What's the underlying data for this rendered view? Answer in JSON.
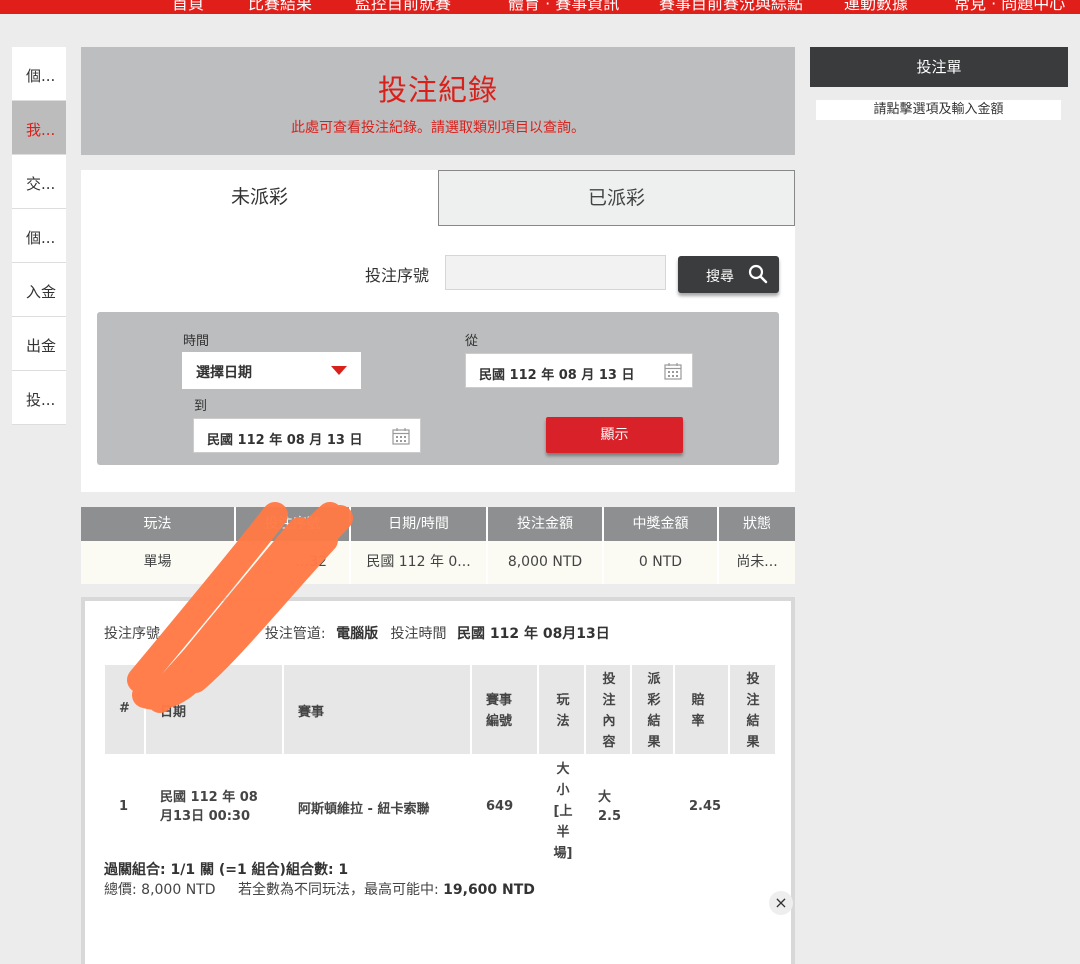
{
  "topnav": {
    "items": [
      "首頁",
      "比賽結果",
      "監控目前就賽",
      "體育 · 賽事資訊",
      "賽事目前賽況與綜點",
      "運動數據",
      "常見 · 問題中心"
    ]
  },
  "sidebar": {
    "items": [
      "個...",
      "我...",
      "交...",
      "個...",
      "入金",
      "出金",
      "投..."
    ],
    "active_index": 1
  },
  "hero": {
    "title": "投注紀錄",
    "subtitle": "此處可查看投注紀錄。請選取類別項目以查詢。"
  },
  "tabs": {
    "unsettled": "未派彩",
    "settled": "已派彩"
  },
  "search": {
    "serial_label": "投注序號",
    "serial_value": "",
    "button_label": "搜尋"
  },
  "filter": {
    "time_label": "時間",
    "select_value": "選擇日期",
    "from_label": "從",
    "from_date": "民國 112 年 08 月 13 日",
    "to_label": "到",
    "to_date": "民國 112 年 08 月 13 日",
    "show_button": "顯示"
  },
  "summary_table": {
    "headers": [
      "玩法",
      "投注序號",
      "日期/時間",
      "投注金額",
      "中獎金額",
      "狀態"
    ],
    "row": [
      "單場",
      "…32",
      "民國 112 年 0...",
      "8,000 NTD",
      "0 NTD",
      "尚未..."
    ]
  },
  "detail": {
    "serial_label": "投注序號",
    "channel_label": "投注管道:",
    "channel_value": "電腦版",
    "time_label": "投注時間",
    "time_value": "民國 112 年 08月13日",
    "headers": [
      "#",
      "日期",
      "賽事",
      "賽事編號",
      "玩法",
      "投注內容",
      "派彩結果",
      "賠率",
      "投注結果"
    ],
    "row": {
      "index": "1",
      "date": "民國 112 年 08月13日 00:30",
      "event": "阿斯頓維拉 - 紐卡索聯",
      "event_no": "649",
      "play": "大小[上半場]",
      "bet": "大 2.5",
      "payout": "",
      "odds": "2.45",
      "result": ""
    },
    "combo": "過關組合: 1/1 關 (=1 組合)組合數: 1",
    "total_label": "總價:",
    "total_value": "8,000 NTD",
    "max_label": "若全數為不同玩法，最高可能中:",
    "max_value": "19,600 NTD",
    "close": "×"
  },
  "slip": {
    "title": "投注單",
    "hint": "請點擊選項及輸入金額"
  },
  "colors": {
    "brand_red": "#e01f1a",
    "accent_red": "#d9211c",
    "dark": "#3a3b3c",
    "scribble": "#ff7a45"
  },
  "icons": {
    "search": "search-icon",
    "calendar": "calendar-icon",
    "dropdown": "caret-down-icon",
    "close": "close-icon"
  }
}
